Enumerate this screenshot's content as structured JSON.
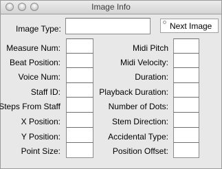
{
  "window": {
    "title": "Image Info"
  },
  "image_type": {
    "label": "Image Type:",
    "value": ""
  },
  "next_button": {
    "label": "Next Image"
  },
  "left_fields": [
    {
      "label": "Measure Num:",
      "value": ""
    },
    {
      "label": "Beat Position:",
      "value": ""
    },
    {
      "label": "Voice Num:",
      "value": ""
    },
    {
      "label": "Staff ID:",
      "value": ""
    },
    {
      "label": "Steps From Staff",
      "value": ""
    },
    {
      "label": "X Position:",
      "value": ""
    },
    {
      "label": "Y Position:",
      "value": ""
    },
    {
      "label": "Point Size:",
      "value": ""
    }
  ],
  "right_fields": [
    {
      "label": "Midi Pitch",
      "value": ""
    },
    {
      "label": "Midi Velocity:",
      "value": ""
    },
    {
      "label": "Duration:",
      "value": ""
    },
    {
      "label": "Playback Duration:",
      "value": ""
    },
    {
      "label": "Number of Dots:",
      "value": ""
    },
    {
      "label": "Stem Direction:",
      "value": ""
    },
    {
      "label": "Accidental Type:",
      "value": ""
    },
    {
      "label": "Position Offset:",
      "value": ""
    }
  ]
}
